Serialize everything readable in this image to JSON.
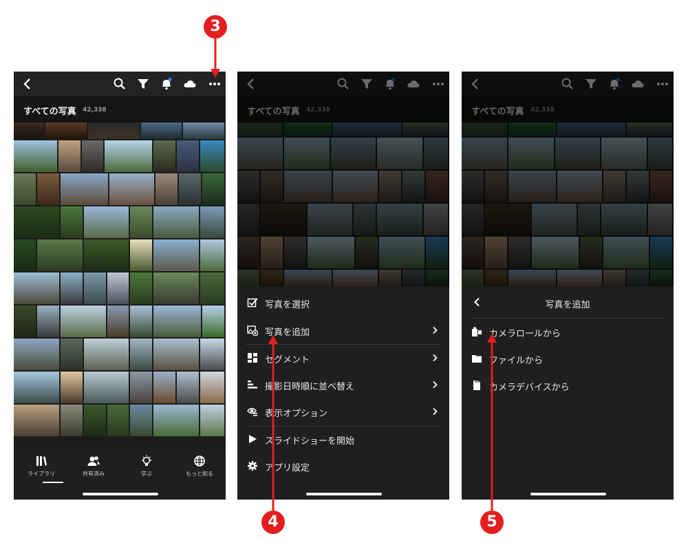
{
  "header": {
    "title": "すべての写真",
    "count": "42,338"
  },
  "nav": [
    {
      "label": "ライブラリ",
      "icon": "library-icon"
    },
    {
      "label": "共有済み",
      "icon": "shared-people-icon"
    },
    {
      "label": "学ぶ",
      "icon": "lightbulb-icon"
    },
    {
      "label": "もっと知る",
      "icon": "globe-icon"
    }
  ],
  "menu": {
    "items": [
      {
        "label": "写真を選択",
        "icon": "checkbox-icon",
        "chevron": false
      },
      {
        "label": "写真を追加",
        "icon": "add-photo-icon",
        "chevron": true
      },
      {
        "label": "セグメント",
        "icon": "segment-icon",
        "chevron": true
      },
      {
        "label": "撮影日時順に並べ替え",
        "icon": "sort-icon",
        "chevron": true
      },
      {
        "label": "表示オプション",
        "icon": "view-options-icon",
        "chevron": true
      },
      {
        "label": "スライドショーを開始",
        "icon": "play-icon",
        "chevron": false
      },
      {
        "label": "アプリ設定",
        "icon": "gear-icon",
        "chevron": false
      }
    ]
  },
  "submenu": {
    "title": "写真を追加",
    "items": [
      {
        "label": "カメラロールから",
        "icon": "camera-roll-icon"
      },
      {
        "label": "ファイルから",
        "icon": "folder-icon"
      },
      {
        "label": "カメラデバイスから",
        "icon": "memory-card-icon"
      }
    ]
  },
  "markers": [
    "3",
    "4",
    "5"
  ],
  "colors": {
    "marker": "#e41e1e",
    "background": "#1c1c1c",
    "notification_dot": "#2f7fe6"
  }
}
